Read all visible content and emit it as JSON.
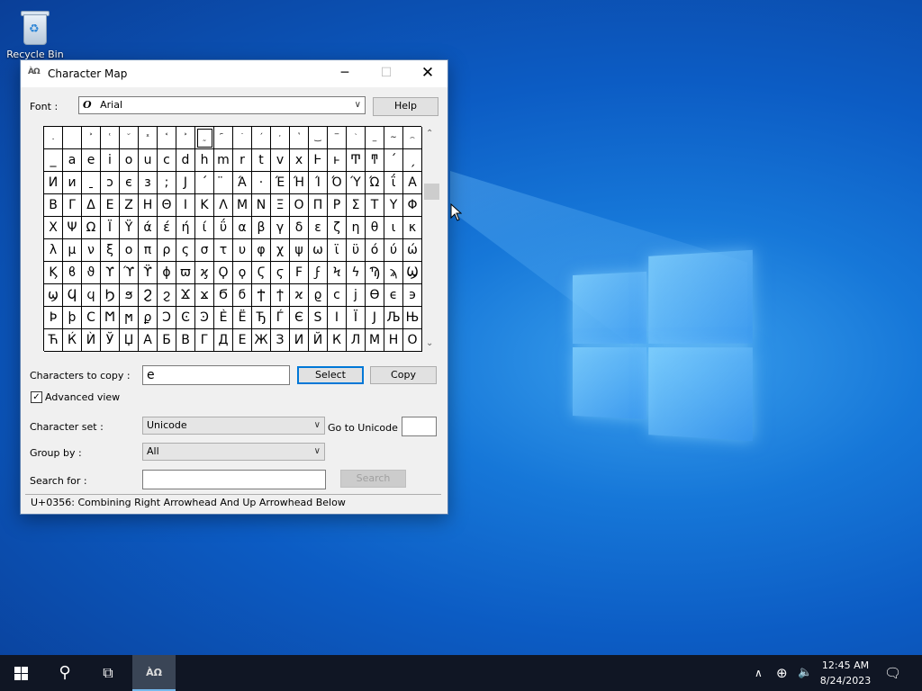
{
  "desktop": {
    "recycle_bin_label": "Recycle Bin"
  },
  "window": {
    "title": "Character Map",
    "minimize_glyph": "─",
    "maximize_glyph": "☐",
    "close_glyph": "✕",
    "font_label": "Font :",
    "font_value": "Arial",
    "font_glyph": "O",
    "help_label": "Help",
    "characters_to_copy_label": "Characters to copy :",
    "characters_to_copy_value": "e",
    "select_label": "Select",
    "copy_label": "Copy",
    "advanced_view_label": "Advanced view",
    "advanced_view_checked": true,
    "character_set_label": "Character set :",
    "character_set_value": "Unicode",
    "go_to_unicode_label": "Go to Unicode :",
    "group_by_label": "Group by :",
    "group_by_value": "All",
    "search_for_label": "Search for :",
    "search_label": "Search",
    "status_text": "U+0356: Combining Right Arrowhead And Up Arrowhead Below"
  },
  "grid": {
    "rows": [
      [
        ".",
        " ",
        "˃",
        "ʿ",
        "᷃",
        "ˣ",
        "˂",
        "˃",
        "˷",
        "᷇",
        "˙",
        "ˊ",
        "ˑ",
        "ʽ",
        "‿",
        "‾",
        "‵",
        "_",
        "∼",
        "⌢"
      ],
      [
        "_",
        "a",
        "e",
        "i",
        "o",
        "u",
        "c",
        "d",
        "h",
        "m",
        "r",
        "t",
        "v",
        "x",
        "Ͱ",
        "ͱ",
        "Ͳ",
        "ͳ",
        "´",
        "ˏ"
      ],
      [
        "И",
        "и",
        "ˍ",
        "ɔ",
        "є",
        "з",
        ";",
        "Ј",
        "´",
        "̈",
        "Ά",
        "·",
        "Έ",
        "Ή",
        "Ί",
        "Ό",
        "Ύ",
        "Ώ",
        "ΐ",
        "Α"
      ],
      [
        "Β",
        "Γ",
        "Δ",
        "Ε",
        "Ζ",
        "Η",
        "Θ",
        "Ι",
        "Κ",
        "Λ",
        "Μ",
        "Ν",
        "Ξ",
        "Ο",
        "Π",
        "Ρ",
        "Σ",
        "Τ",
        "Υ",
        "Φ"
      ],
      [
        "Χ",
        "Ψ",
        "Ω",
        "Ϊ",
        "Ϋ",
        "ά",
        "έ",
        "ή",
        "ί",
        "ΰ",
        "α",
        "β",
        "γ",
        "δ",
        "ε",
        "ζ",
        "η",
        "θ",
        "ι",
        "κ"
      ],
      [
        "λ",
        "μ",
        "ν",
        "ξ",
        "ο",
        "π",
        "ρ",
        "ς",
        "σ",
        "τ",
        "υ",
        "φ",
        "χ",
        "ψ",
        "ω",
        "ϊ",
        "ϋ",
        "ό",
        "ύ",
        "ώ"
      ],
      [
        "Ϗ",
        "ϐ",
        "ϑ",
        "ϒ",
        "ϓ",
        "ϔ",
        "ϕ",
        "ϖ",
        "ϗ",
        "Ϙ",
        "ϙ",
        "Ϛ",
        "ϛ",
        "Ϝ",
        "ϝ",
        "Ϟ",
        "ϟ",
        "Ϡ",
        "ϡ",
        "Ϣ"
      ],
      [
        "ϣ",
        "Ϥ",
        "ϥ",
        "Ϧ",
        "ϧ",
        "Ϩ",
        "ϩ",
        "Ϫ",
        "ϫ",
        "Ϭ",
        "ϭ",
        "Ϯ",
        "ϯ",
        "ϰ",
        "ϱ",
        "ϲ",
        "ϳ",
        "ϴ",
        "ϵ",
        "϶"
      ],
      [
        "Ϸ",
        "ϸ",
        "Ϲ",
        "Ϻ",
        "ϻ",
        "ϼ",
        "Ͻ",
        "Ͼ",
        "Ͽ",
        "Ѐ",
        "Ё",
        "Ђ",
        "Ѓ",
        "Є",
        "Ѕ",
        "І",
        "Ї",
        "Ј",
        "Љ",
        "Њ"
      ],
      [
        "Ћ",
        "Ќ",
        "Ѝ",
        "Ў",
        "Џ",
        "А",
        "Б",
        "В",
        "Г",
        "Д",
        "Е",
        "Ж",
        "З",
        "И",
        "Й",
        "К",
        "Л",
        "М",
        "Н",
        "О"
      ]
    ],
    "selected_row": 0,
    "selected_col": 8
  },
  "taskbar": {
    "clock_time": "12:45 AM",
    "clock_date": "8/24/2023",
    "search_glyph": "⚲",
    "task_view_glyph": "⧉",
    "charmap_glyph": "ÀΩ",
    "chevron_glyph": "∧",
    "network_glyph": "⊕",
    "volume_glyph": "🔈",
    "notification_glyph": "🗨"
  }
}
